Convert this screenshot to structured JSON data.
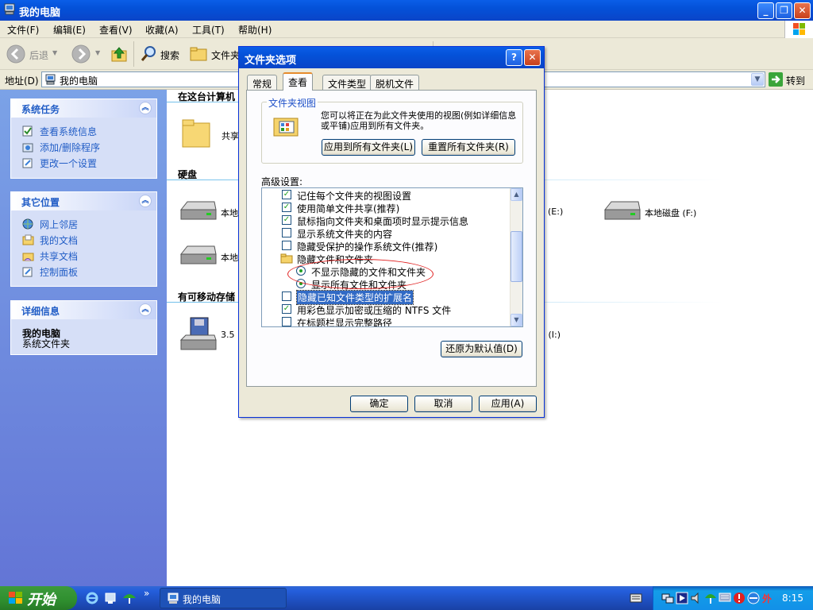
{
  "window": {
    "title": "我的电脑"
  },
  "menu": [
    "文件(F)",
    "编辑(E)",
    "查看(V)",
    "收藏(A)",
    "工具(T)",
    "帮助(H)"
  ],
  "toolbar": {
    "back": "后退",
    "search": "搜索",
    "folders": "文件夹"
  },
  "address": {
    "label": "地址(D)",
    "value": "我的电脑",
    "go": "转到"
  },
  "left": {
    "system_tasks": {
      "title": "系统任务",
      "items": [
        "查看系统信息",
        "添加/删除程序",
        "更改一个设置"
      ]
    },
    "other_places": {
      "title": "其它位置",
      "items": [
        "网上邻居",
        "我的文档",
        "共享文档",
        "控制面板"
      ]
    },
    "details": {
      "title": "详细信息",
      "name": "我的电脑",
      "desc": "系统文件夹"
    }
  },
  "right": {
    "sec_files": "在这台计算机",
    "shared": "共享",
    "sec_disks": "硬盘",
    "disk1": "本地",
    "disk2": "本地",
    "disk_e": "(E:)",
    "disk_f": "本地磁盘 (F:)",
    "sec_removable": "有可移动存储",
    "floppy": "3.5",
    "drive_i": "2 (I:)"
  },
  "dialog": {
    "title": "文件夹选项",
    "help": "?",
    "tabs": [
      "常规",
      "查看",
      "文件类型",
      "脱机文件"
    ],
    "group_title": "文件夹视图",
    "group_text": "您可以将正在为此文件夹使用的视图(例如详细信息或平铺)应用到所有文件夹。",
    "apply_all": "应用到所有文件夹(L)",
    "reset_all": "重置所有文件夹(R)",
    "advanced_label": "高级设置:",
    "items": [
      "记住每个文件夹的视图设置",
      "使用简单文件共享(推荐)",
      "鼠标指向文件夹和桌面项时显示提示信息",
      "显示系统文件夹的内容",
      "隐藏受保护的操作系统文件(推荐)",
      "隐藏文件和文件夹",
      "不显示隐藏的文件和文件夹",
      "显示所有文件和文件夹",
      "隐藏已知文件类型的扩展名",
      "用彩色显示加密或压缩的 NTFS 文件",
      "在标题栏显示完整路径"
    ],
    "restore": "还原为默认值(D)",
    "ok": "确定",
    "cancel": "取消",
    "apply": "应用(A)"
  },
  "taskbar": {
    "start": "开始",
    "task": "我的电脑",
    "clock": "8:15",
    "tray_text": "外"
  }
}
